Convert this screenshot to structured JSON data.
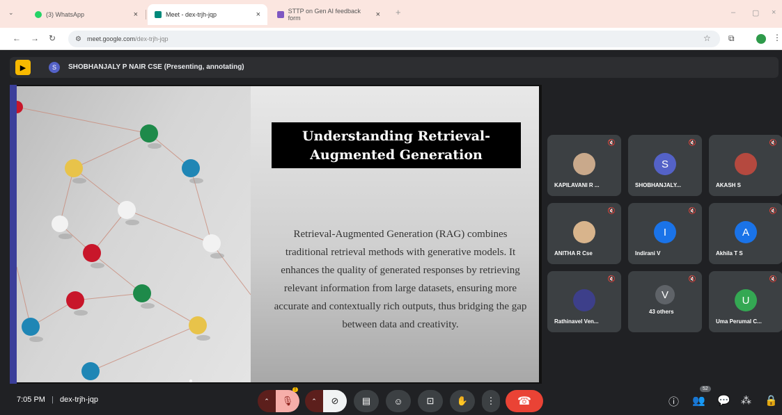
{
  "browser": {
    "tabs": [
      {
        "label": "(3) WhatsApp",
        "close": "×"
      },
      {
        "label": "Meet - dex-trjh-jqp",
        "close": "×"
      },
      {
        "label": "STTP on Gen AI feedback form",
        "close": "×"
      }
    ],
    "new_tab": "+",
    "window_controls": [
      "–",
      "▢",
      "×"
    ],
    "url_host": "meet.google.com",
    "url_path": "/dex-trjh-jqp"
  },
  "meet": {
    "presenter_initial": "S",
    "presenter_label": "SHOBHANJALY P NAIR CSE (Presenting, annotating)",
    "slide": {
      "title": "Understanding Retrieval-Augmented Generation",
      "body": "Retrieval-Augmented Generation (RAG) combines traditional retrieval methods with generative models. It enhances the quality of generated responses by retrieving relevant information from large datasets, ensuring more accurate and contextually rich outputs, thus bridging the gap between data and creativity."
    },
    "participants": [
      {
        "name": "KAPILAVANI R ...",
        "initial": "",
        "color": "#c9a98b"
      },
      {
        "name": "SHOBHANJALY...",
        "initial": "S",
        "color": "#5462c7"
      },
      {
        "name": "AKASH S",
        "initial": "",
        "color": "#b5493f"
      },
      {
        "name": "ANITHA R Cse",
        "initial": "",
        "color": "#d8b48c"
      },
      {
        "name": "Indirani V",
        "initial": "I",
        "color": "#1a73e8"
      },
      {
        "name": "Akhila T S",
        "initial": "A",
        "color": "#1a73e8"
      },
      {
        "name": "Rathinavel Ven...",
        "initial": "",
        "color": "#3d3f8a"
      },
      {
        "name": "43 others",
        "initial": "V",
        "color": "#5f6368"
      },
      {
        "name": "Uma Perumal C...",
        "initial": "U",
        "color": "#34a853"
      }
    ],
    "time": "7:05 PM",
    "separator": "|",
    "meeting_code": "dex-trjh-jqp",
    "mic_badge": "!",
    "people_count": "52"
  },
  "colors": {
    "end_call": "#ea4335",
    "accent": "#1a73e8",
    "meet_bg": "#202124"
  }
}
